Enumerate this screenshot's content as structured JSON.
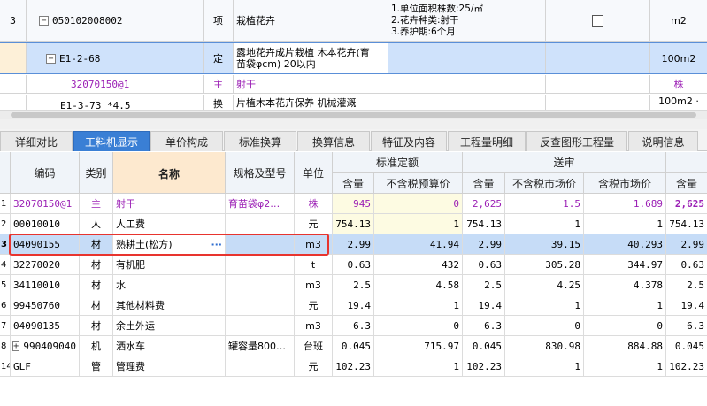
{
  "top_rows": [
    {
      "num": "3",
      "code": "050102008002",
      "type": "项",
      "name": "栽植花卉",
      "features": [
        "1.单位面积株数:25/㎡",
        "2.花卉种类:射干",
        "3.养护期:6个月"
      ],
      "unit": "m2"
    },
    {
      "code": "E1-2-68",
      "type": "定",
      "name_lines": [
        "露地花卉成片栽植 木本花卉(育",
        "苗袋φcm) 20以内"
      ],
      "unit": "100m2"
    },
    {
      "code": "32070150@1",
      "type": "主",
      "name": "射干",
      "unit": "株"
    },
    {
      "code": "E1-3-73 *4.5",
      "type": "换",
      "name": "片植木本花卉保养 机械灌溉",
      "unit": "100m2 ·"
    }
  ],
  "tabs": [
    "详细对比",
    "工料机显示",
    "单价构成",
    "标准换算",
    "换算信息",
    "特征及内容",
    "工程量明细",
    "反查图形工程量",
    "说明信息"
  ],
  "active_tab": "工料机显示",
  "headers": {
    "code": "编码",
    "type": "类别",
    "name": "名称",
    "spec": "规格及型号",
    "unit": "单位",
    "group_std": "标准定额",
    "group_review": "送审",
    "qty": "含量",
    "price_std": "不含税预算价",
    "qty2": "含量",
    "price_mkt": "不含税市场价",
    "price_mkt_tax": "含税市场价",
    "qty3": "含量"
  },
  "rows": [
    {
      "n": "1",
      "code": "32070150@1",
      "type": "主",
      "name": "射干",
      "spec": "育苗袋φ2…",
      "unit": "株",
      "q1": "945",
      "p1": "0",
      "q2": "2,625",
      "p2": "1.5",
      "p3": "1.689",
      "q3": "2,625"
    },
    {
      "n": "2",
      "code": "00010010",
      "type": "人",
      "name": "人工费",
      "spec": "",
      "unit": "元",
      "q1": "754.13",
      "p1": "1",
      "q2": "754.13",
      "p2": "1",
      "p3": "1",
      "q3": "754.13"
    },
    {
      "n": "3",
      "code": "04090155",
      "type": "材",
      "name": "熟耕土(松方)",
      "spec": "",
      "unit": "m3",
      "q1": "2.99",
      "p1": "41.94",
      "q2": "2.99",
      "p2": "39.15",
      "p3": "40.293",
      "q3": "2.99"
    },
    {
      "n": "4",
      "code": "32270020",
      "type": "材",
      "name": "有机肥",
      "spec": "",
      "unit": "t",
      "q1": "0.63",
      "p1": "432",
      "q2": "0.63",
      "p2": "305.28",
      "p3": "344.97",
      "q3": "0.63"
    },
    {
      "n": "5",
      "code": "34110010",
      "type": "材",
      "name": "水",
      "spec": "",
      "unit": "m3",
      "q1": "2.5",
      "p1": "4.58",
      "q2": "2.5",
      "p2": "4.25",
      "p3": "4.378",
      "q3": "2.5"
    },
    {
      "n": "6",
      "code": "99450760",
      "type": "材",
      "name": "其他材料费",
      "spec": "",
      "unit": "元",
      "q1": "19.4",
      "p1": "1",
      "q2": "19.4",
      "p2": "1",
      "p3": "1",
      "q3": "19.4"
    },
    {
      "n": "7",
      "code": "04090135",
      "type": "材",
      "name": "余土外运",
      "spec": "",
      "unit": "m3",
      "q1": "6.3",
      "p1": "0",
      "q2": "6.3",
      "p2": "0",
      "p3": "0",
      "q3": "6.3"
    },
    {
      "n": "8",
      "code": "990409040",
      "type": "机",
      "name": "洒水车",
      "spec": "罐容量800…",
      "unit": "台班",
      "q1": "0.045",
      "p1": "715.97",
      "q2": "0.045",
      "p2": "830.98",
      "p3": "884.88",
      "q3": "0.045"
    },
    {
      "n": "14",
      "code": "GLF",
      "type": "管",
      "name": "管理费",
      "spec": "",
      "unit": "元",
      "q1": "102.23",
      "p1": "1",
      "q2": "102.23",
      "p2": "1",
      "p3": "1",
      "q3": "102.23"
    }
  ],
  "colors": {
    "accent": "#3a7fd5",
    "highlight": "#e8342e",
    "purple": "#9b1fb5"
  }
}
